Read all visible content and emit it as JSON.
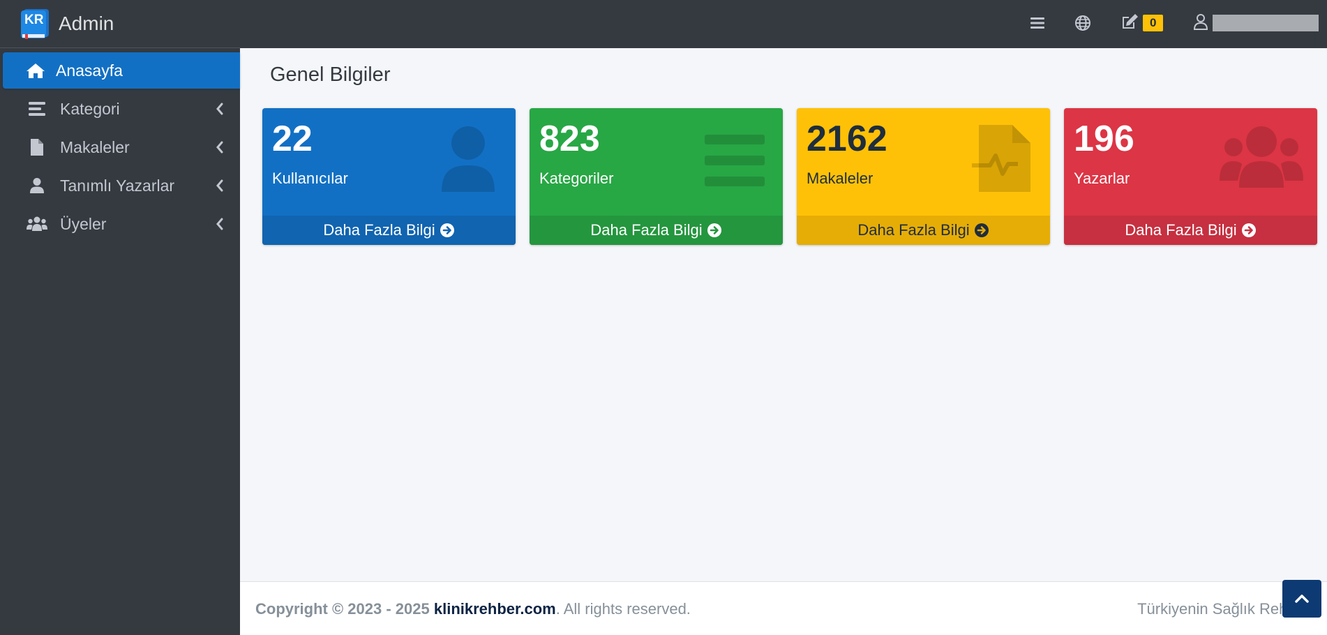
{
  "brand": {
    "logo_text": "KR",
    "title": "Admin"
  },
  "sidebar": {
    "items": [
      {
        "label": "Anasayfa",
        "icon": "home-icon",
        "active": true
      },
      {
        "label": "Kategori",
        "icon": "list-icon",
        "has_submenu": true
      },
      {
        "label": "Makaleler",
        "icon": "file-icon",
        "has_submenu": true
      },
      {
        "label": "Tanımlı Yazarlar",
        "icon": "user-icon",
        "has_submenu": true
      },
      {
        "label": "Üyeler",
        "icon": "users-icon",
        "has_submenu": true
      }
    ]
  },
  "topbar": {
    "icons": [
      "menu-icon",
      "globe-icon",
      "edit-icon",
      "user-icon"
    ],
    "edit_badge": "0"
  },
  "content": {
    "title": "Genel Bilgiler",
    "boxes": [
      {
        "value": "22",
        "label": "Kullanıcılar",
        "link": "Daha Fazla Bilgi",
        "icon": "user-icon",
        "color": "#1270c4"
      },
      {
        "value": "823",
        "label": "Kategoriler",
        "link": "Daha Fazla Bilgi",
        "icon": "list-icon",
        "color": "#28a745"
      },
      {
        "value": "2162",
        "label": "Makaleler",
        "link": "Daha Fazla Bilgi",
        "icon": "file-medical-icon",
        "color": "#ffc107"
      },
      {
        "value": "196",
        "label": "Yazarlar",
        "link": "Daha Fazla Bilgi",
        "icon": "users-icon",
        "color": "#dc3545"
      }
    ]
  },
  "footer": {
    "copyright_prefix": "Copyright © 2023 - 2025",
    "site": "klinikrehber.com",
    "rights": ". All rights reserved.",
    "right_text": "Türkiyenin Sağlık Rehberi"
  }
}
